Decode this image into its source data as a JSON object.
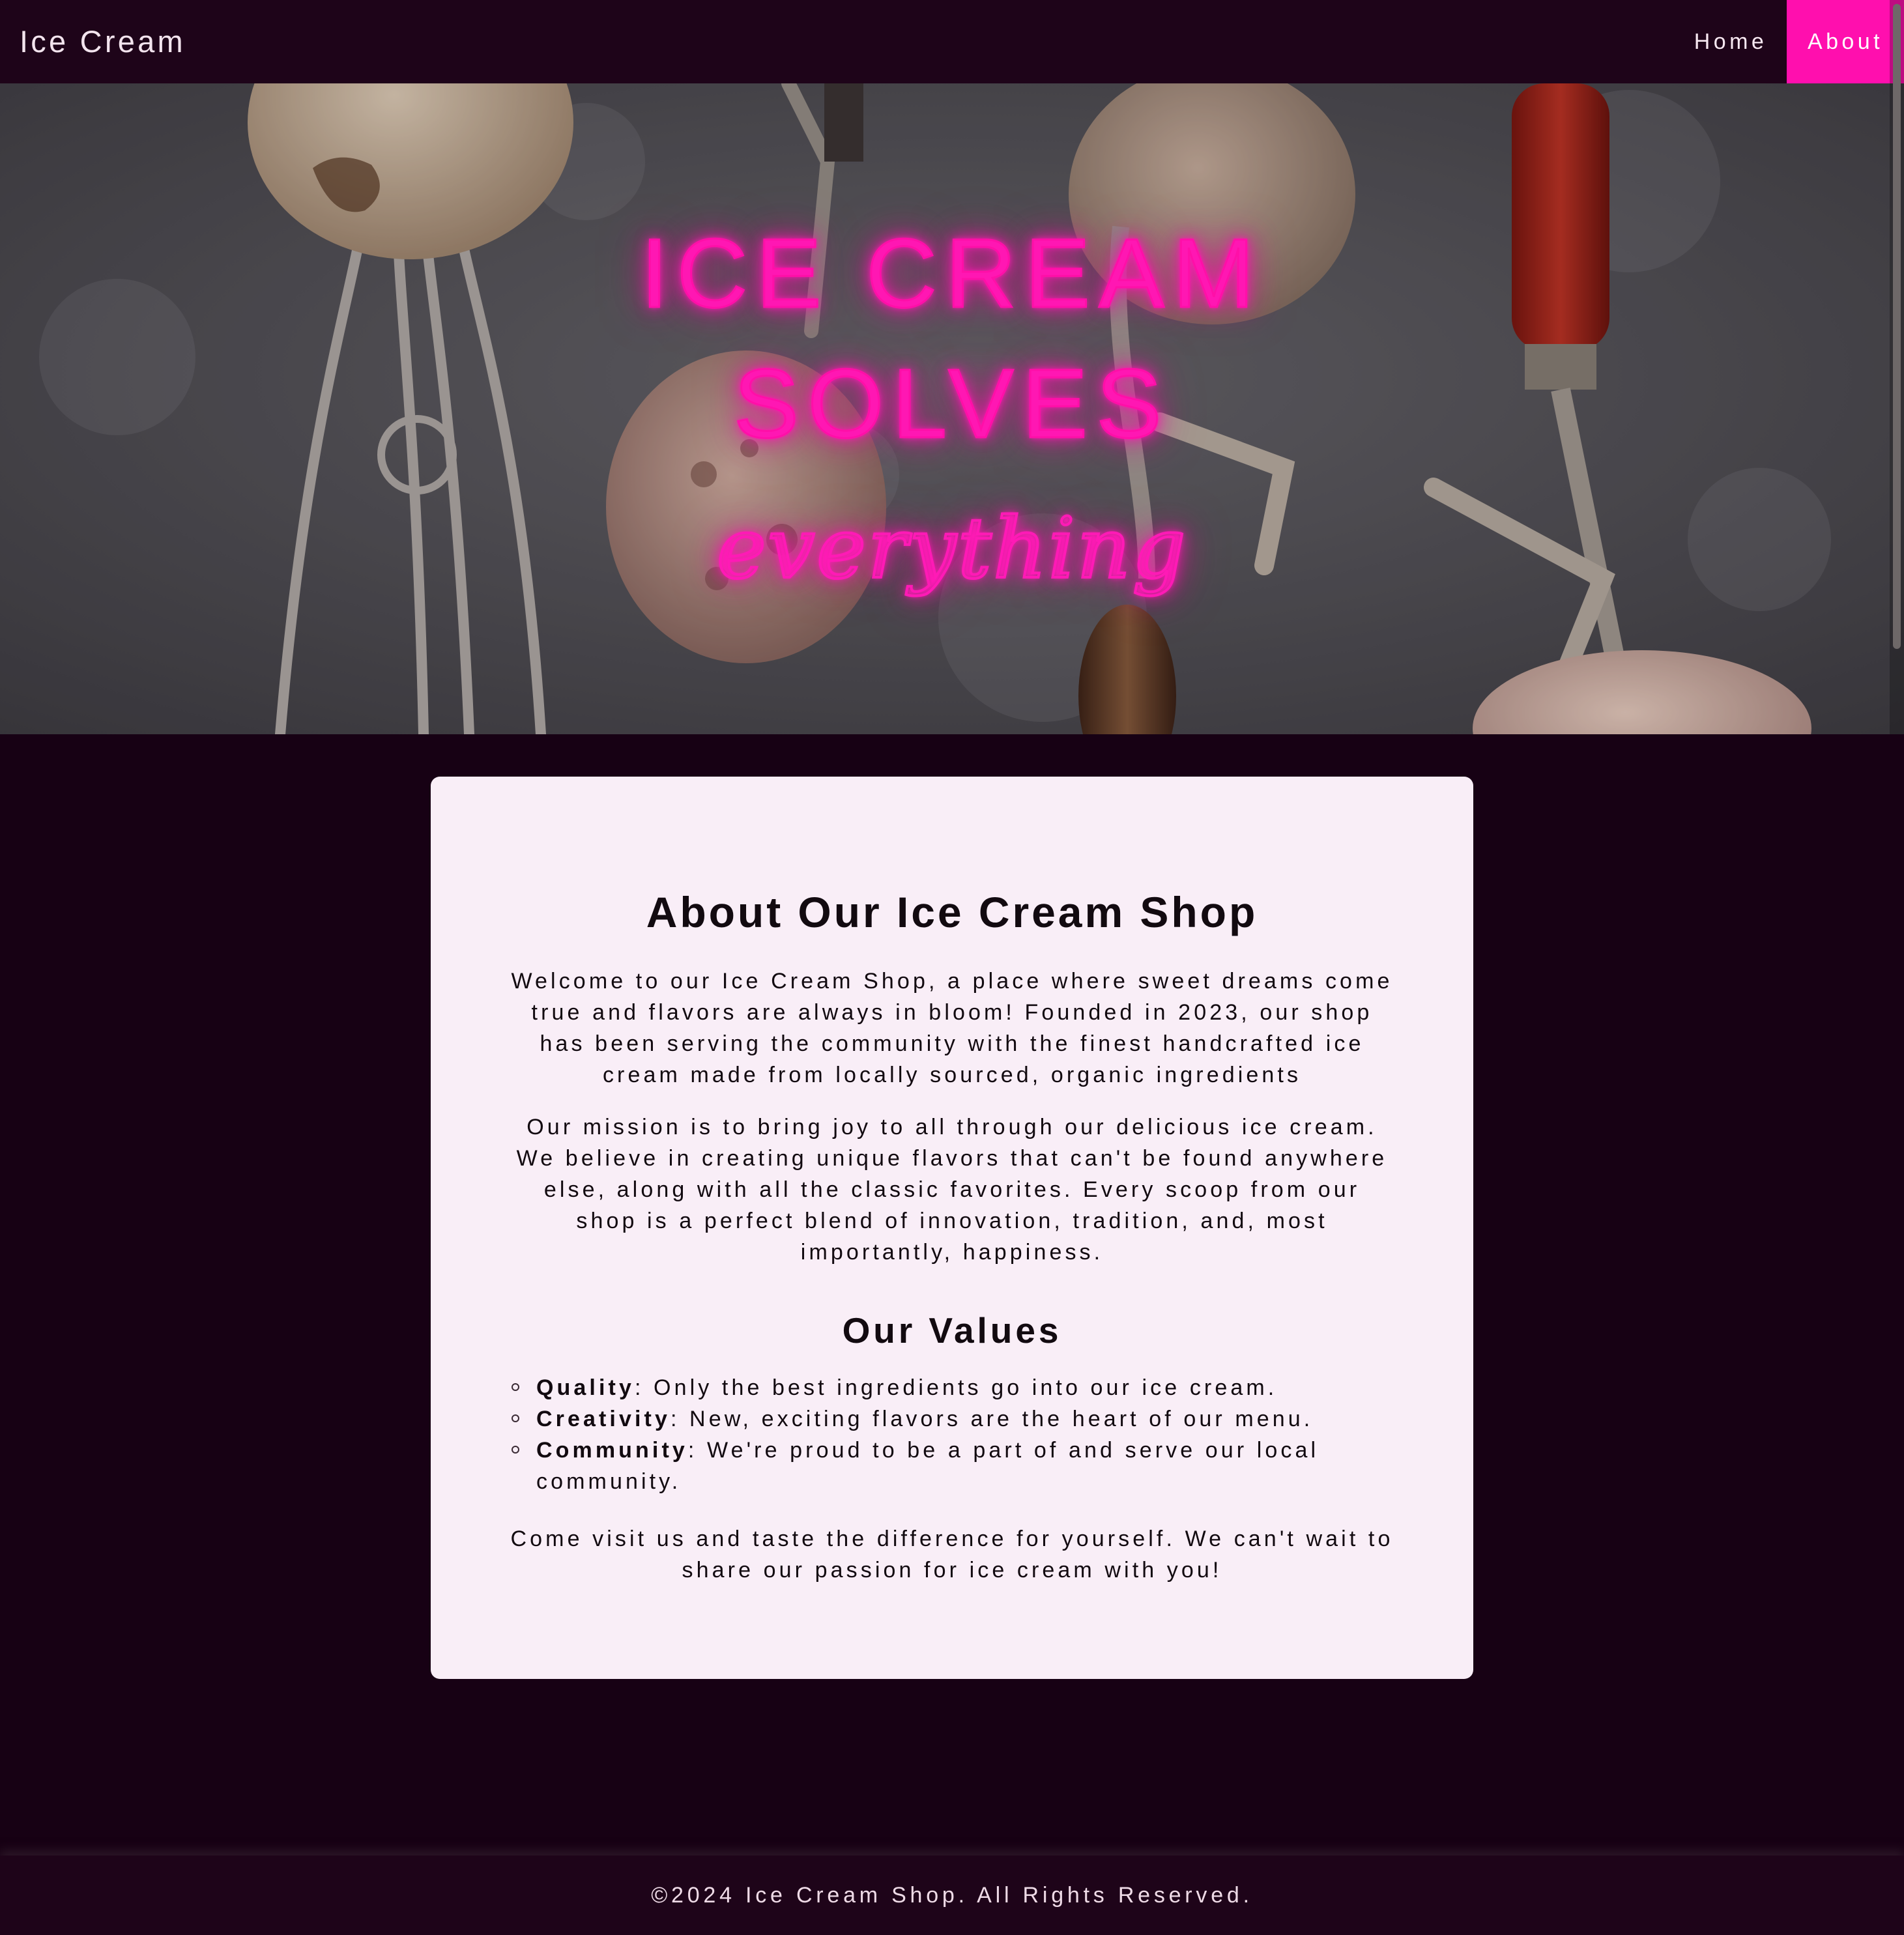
{
  "navbar": {
    "brand": "Ice Cream",
    "links": [
      {
        "label": "Home",
        "active": false
      },
      {
        "label": "About",
        "active": true
      }
    ],
    "active_color": "#ff0fae"
  },
  "hero": {
    "line1": "ICE CREAM",
    "line2": "SOLVES",
    "line3": "everything",
    "neon_color": "#ff1ab6"
  },
  "about": {
    "title": "About Our Ice Cream Shop",
    "paragraphs": [
      "Welcome to our Ice Cream Shop, a place where sweet dreams come true and flavors are always in bloom! Founded in 2023, our shop has been serving the community with the finest handcrafted ice cream made from locally sourced, organic ingredients",
      "Our mission is to bring joy to all through our delicious ice cream. We believe in creating unique flavors that can't be found anywhere else, along with all the classic favorites. Every scoop from our shop is a perfect blend of innovation, tradition, and, most importantly, happiness."
    ],
    "values_title": "Our Values",
    "values": [
      {
        "name": "Quality",
        "text": ": Only the best ingredients go into our ice cream."
      },
      {
        "name": "Creativity",
        "text": ": New, exciting flavors are the heart of our menu."
      },
      {
        "name": "Community",
        "text": ": We're proud to be a part of and serve our local community."
      }
    ],
    "closing": "Come visit us and taste the difference for yourself. We can't wait to share our passion for ice cream with you!"
  },
  "footer": {
    "text": "©2024 Ice Cream Shop. All Rights Reserved."
  },
  "colors": {
    "page_background": "#170114",
    "nav_background": "#1e0419",
    "card_background": "#f9eef7"
  }
}
